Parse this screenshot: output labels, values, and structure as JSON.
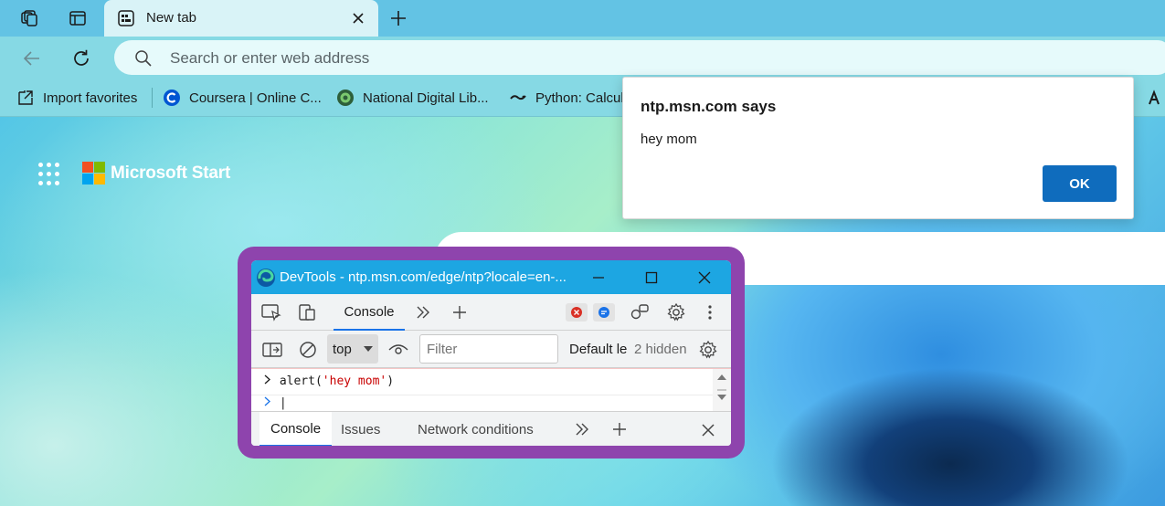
{
  "browser": {
    "tabs": [
      {
        "label": "New tab",
        "active": true
      }
    ],
    "address_bar": {
      "placeholder": "Search or enter web address"
    },
    "favorites": [
      {
        "label": "Import favorites",
        "icon": "import-favorites-icon"
      },
      {
        "label": "Coursera | Online C...",
        "icon": "coursera-icon"
      },
      {
        "label": "National Digital Lib...",
        "icon": "ndl-icon"
      },
      {
        "label": "Python: Calcul",
        "icon": "python-site-icon"
      }
    ]
  },
  "page": {
    "brand": "Microsoft Start"
  },
  "alert": {
    "title": "ntp.msn.com says",
    "message": "hey mom",
    "ok_label": "OK"
  },
  "devtools": {
    "title": "DevTools - ntp.msn.com/edge/ntp?locale=en-...",
    "main_tab": "Console",
    "context": "top",
    "filter_placeholder": "Filter",
    "levels": "Default le",
    "hidden": "2 hidden",
    "console": {
      "command": "alert(",
      "command_arg": "'hey mom'",
      "command_end": ")",
      "prompt": "|"
    },
    "drawer_tabs": [
      "Console",
      "Issues",
      "Network conditions"
    ]
  },
  "colors": {
    "tabstrip": "#63c3e4",
    "toolbar": "#86d9e4",
    "devtools_title": "#1da6e2",
    "devtools_frame": "#8e44ad",
    "ok_button": "#0f6cbd",
    "accent": "#1a73e8"
  }
}
